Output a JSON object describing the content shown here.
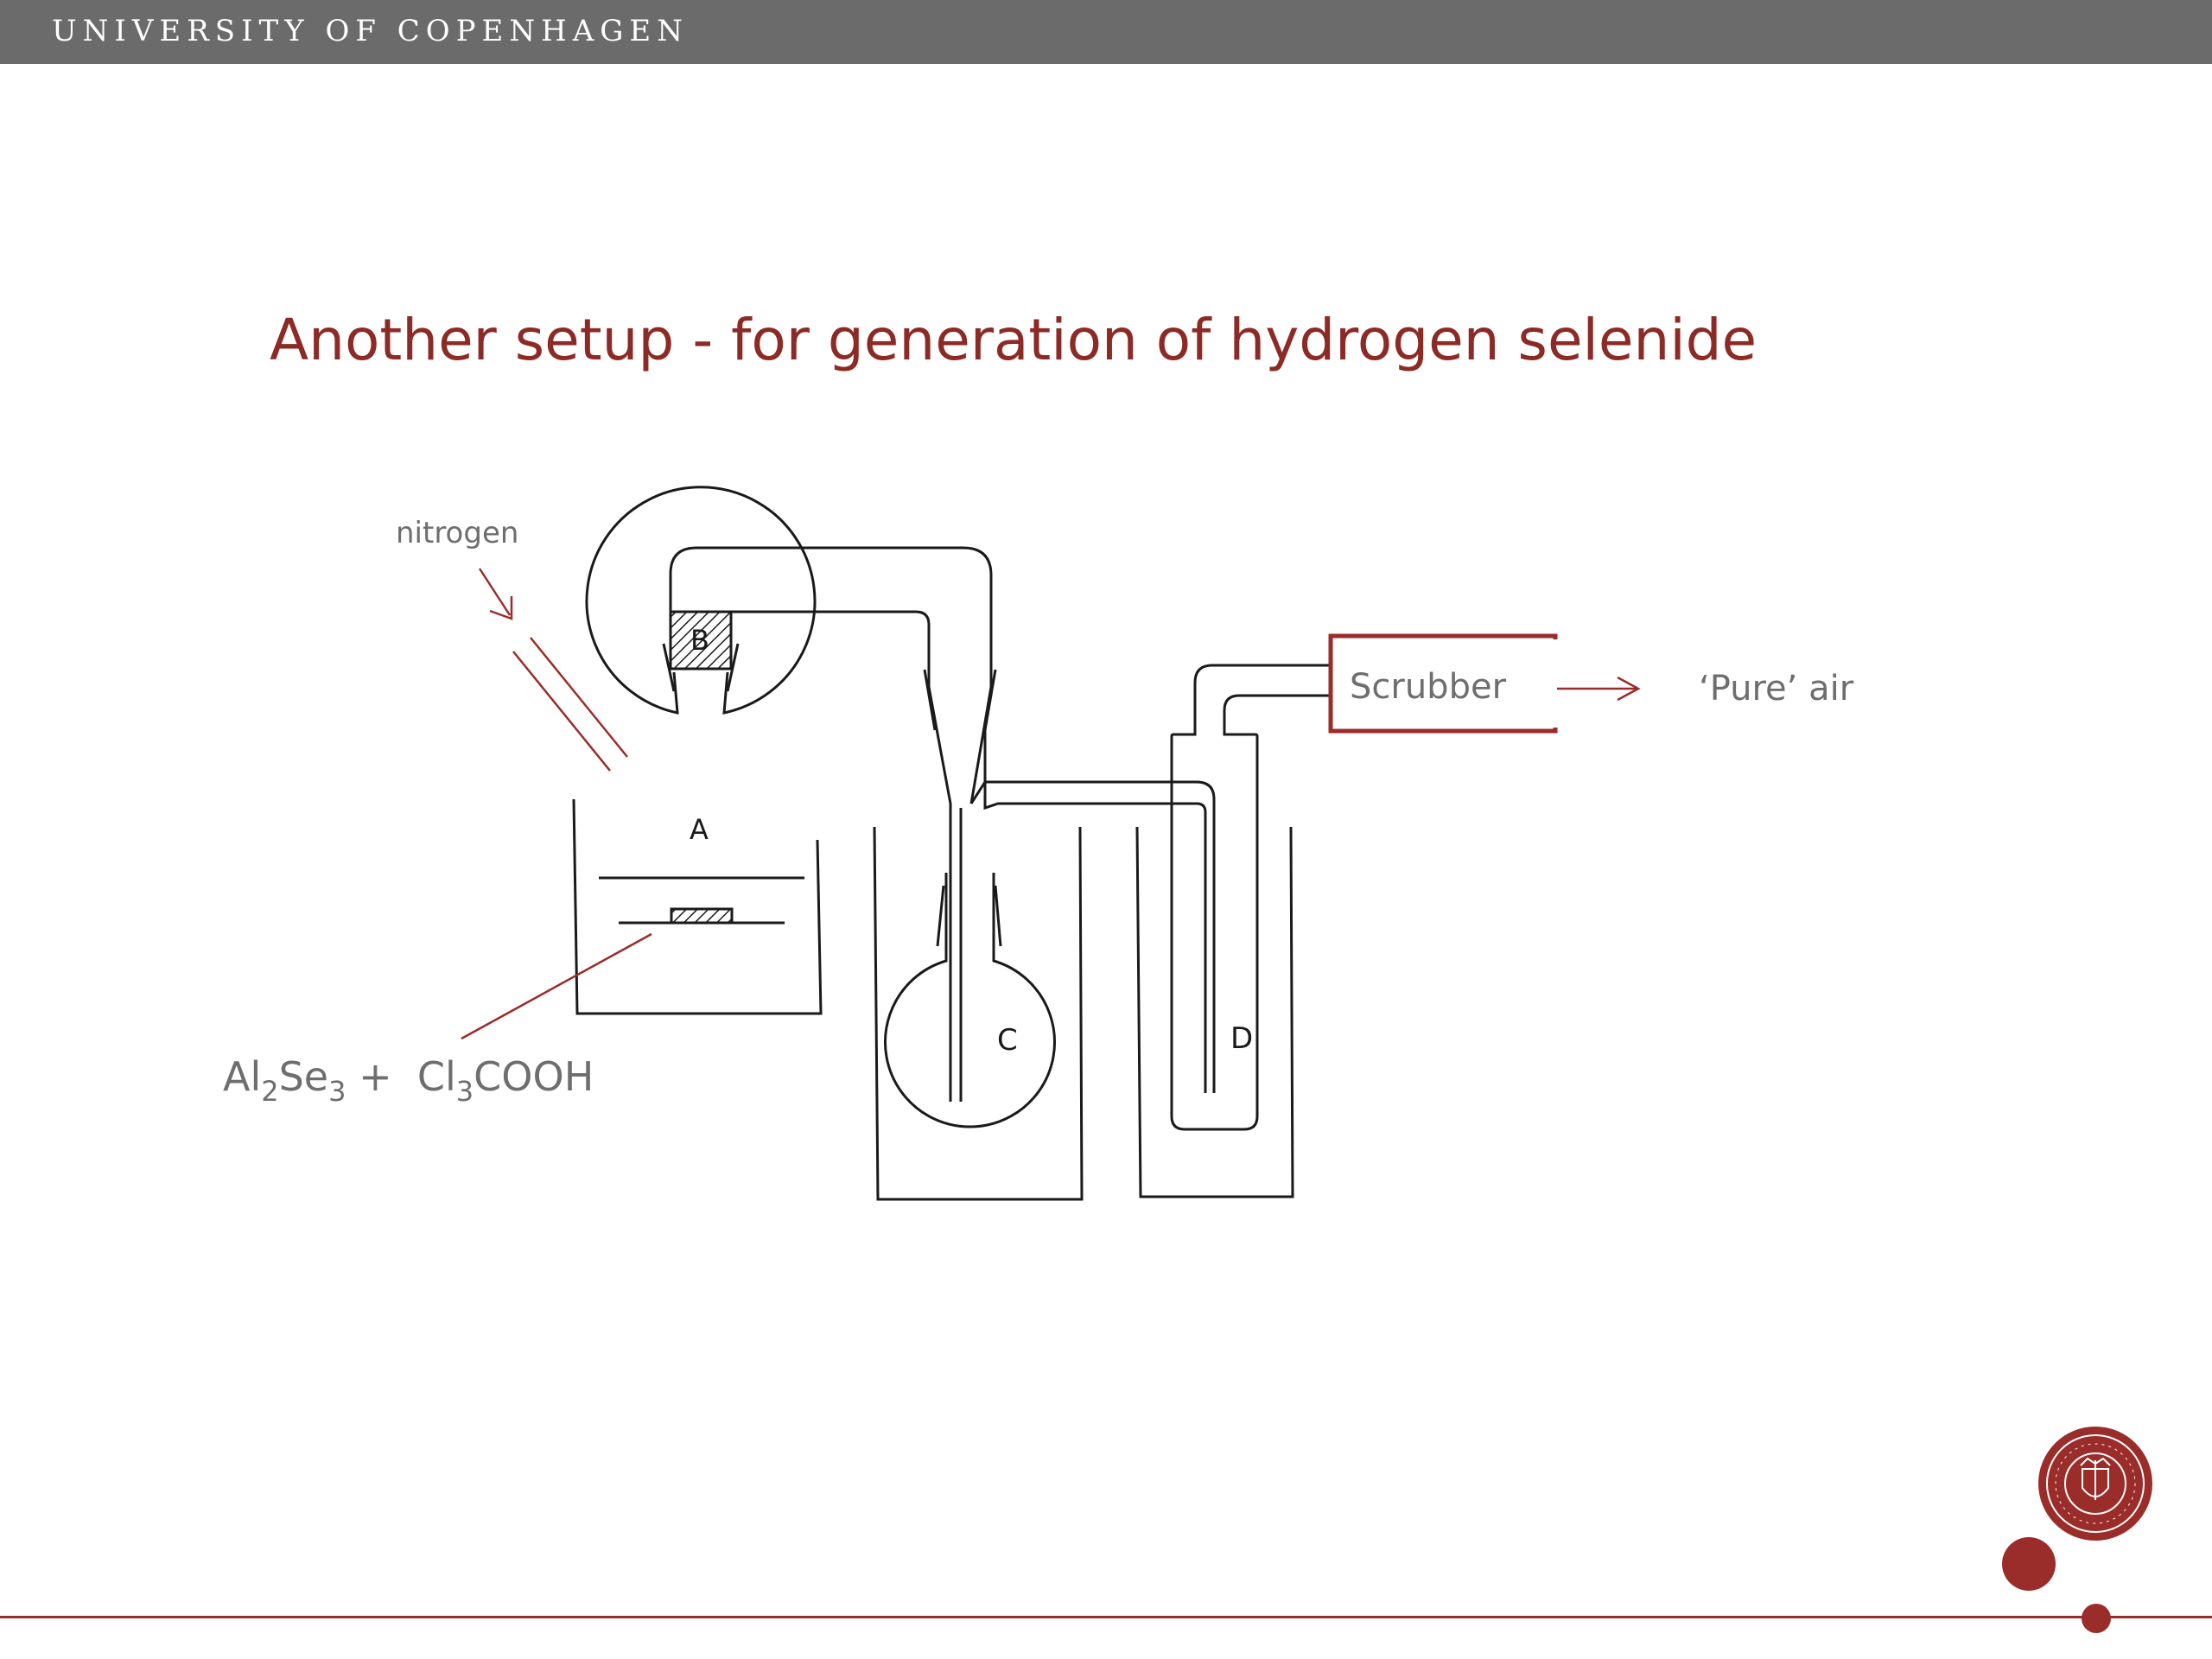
{
  "header": {
    "title": "UNIVERSITY OF COPENHAGEN"
  },
  "slide": {
    "title": "Another setup - for generation of hydrogen selenide"
  },
  "diagram": {
    "nitrogen_label": "nitrogen",
    "label_a": "A",
    "label_b": "B",
    "label_c": "C",
    "label_d": "D",
    "scrubber_label": "Scrubber",
    "pure_air_label": "‘Pure’ air",
    "reagents": {
      "al": "Al",
      "sub2": "2",
      "se": "Se",
      "sub3a": "3",
      "plus": " +  ",
      "cl": "Cl",
      "sub3b": "3",
      "cooh": "COOH"
    }
  },
  "colors": {
    "accent": "#9a2c29",
    "header_bg": "#6b6b6b",
    "title": "#8c2a26",
    "label_gray": "#6e6e6e",
    "ink": "#1a1a1a"
  },
  "logo": {
    "name": "university-seal-icon"
  }
}
